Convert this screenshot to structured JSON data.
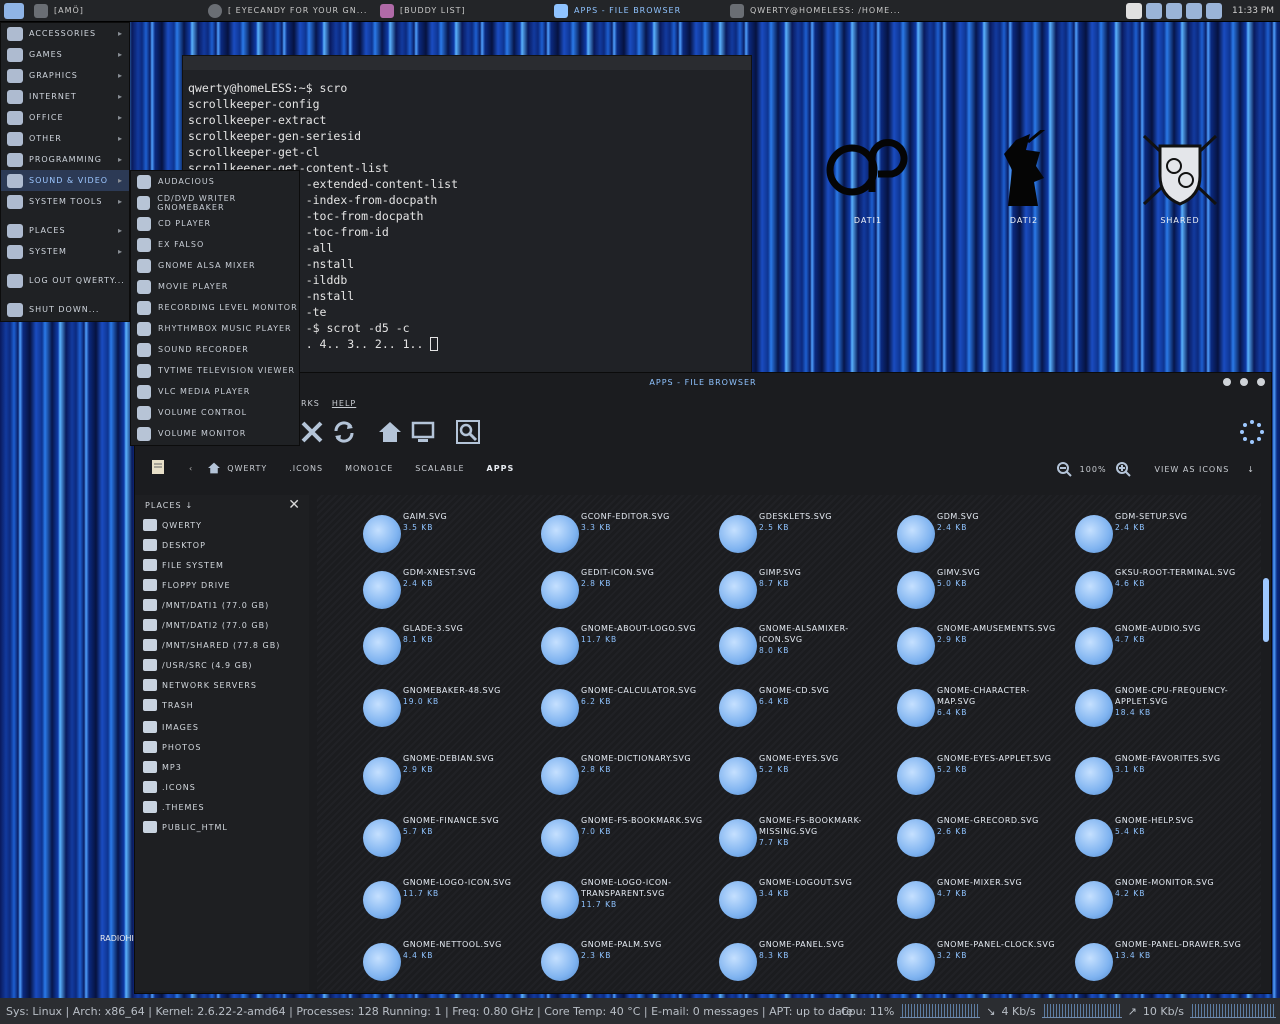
{
  "top_panel": {
    "menu_label": "[amö]",
    "tasks": [
      {
        "label": "[ eyecandy for your gn..."
      },
      {
        "label": "[buddy list]"
      },
      {
        "label": "apps - file browser"
      },
      {
        "label": "qwerty@homeless: /home..."
      }
    ],
    "clock": "11:33 PM"
  },
  "app_menu": {
    "items": [
      {
        "label": "Accessories",
        "submenu": true
      },
      {
        "label": "Games",
        "submenu": true
      },
      {
        "label": "Graphics",
        "submenu": true
      },
      {
        "label": "Internet",
        "submenu": true
      },
      {
        "label": "Office",
        "submenu": true
      },
      {
        "label": "Other",
        "submenu": true
      },
      {
        "label": "Programming",
        "submenu": true
      },
      {
        "label": "Sound & Video",
        "submenu": true,
        "active": true
      },
      {
        "label": "System Tools",
        "submenu": true
      }
    ],
    "items2": [
      {
        "label": "Places",
        "submenu": true
      },
      {
        "label": "System",
        "submenu": true
      }
    ],
    "logout": "Log Out qwerty...",
    "shutdown": "Shut Down..."
  },
  "sound_video_menu": [
    "Audacious",
    "CD/DVD Writer GnomeBaker",
    "CD Player",
    "Ex Falso",
    "GNOME ALSA Mixer",
    "Movie Player",
    "Recording Level Monitor",
    "Rhythmbox Music Player",
    "Sound Recorder",
    "tvtime Television Viewer",
    "VLC media player",
    "Volume Control",
    "Volume Monitor"
  ],
  "terminal": {
    "lines": [
      "qwerty@homeLESS:~$ scro",
      "scrollkeeper-config",
      "scrollkeeper-extract",
      "scrollkeeper-gen-seriesid",
      "scrollkeeper-get-cl",
      "scrollkeeper-get-content-list",
      "                 -extended-content-list",
      "                 -index-from-docpath",
      "                 -toc-from-docpath",
      "                 -toc-from-id",
      "                 -all",
      "                 -nstall",
      "                 -ilddb",
      "                 -nstall",
      "                 -te",
      "",
      "                 -$ scrot -d5 -c",
      "                 . 4.. 3.. 2.. 1.."
    ]
  },
  "desktop": {
    "icons": [
      {
        "label": "DATI1"
      },
      {
        "label": "DATI2"
      },
      {
        "label": "SHARED"
      }
    ],
    "radio_label": "RADIOHI"
  },
  "file_browser": {
    "title": "apps - file browser",
    "menu": [
      "rks",
      "Help"
    ],
    "breadcrumbs": [
      "qwerty",
      ".icons",
      "mono1ce",
      "scalable",
      "apps"
    ],
    "zoom": "100%",
    "view_as": "View as Icons",
    "sidebar_header": "Places",
    "places": [
      "qwerty",
      "Desktop",
      "File System",
      "Floppy Drive",
      "/mnt/dati1 (77.0 GB)",
      "/mnt/dati2 (77.0 GB)",
      "/mnt/shared (77.8 GB)",
      "/usr/src (4.9 GB)",
      "Network Servers",
      "Trash"
    ],
    "bookmarks": [
      "images",
      "photos",
      "mp3",
      ".icons",
      ".themes",
      "public_html"
    ],
    "files": [
      {
        "name": "gaim.svg",
        "size": "3.5 KB"
      },
      {
        "name": "gconf-editor.svg",
        "size": "3.3 KB"
      },
      {
        "name": "gdesklets.svg",
        "size": "2.5 KB"
      },
      {
        "name": "gdm.svg",
        "size": "2.4 KB"
      },
      {
        "name": "gdm-setup.svg",
        "size": "2.4 KB"
      },
      {
        "name": "gdm-xnest.svg",
        "size": "2.4 KB"
      },
      {
        "name": "gedit-icon.svg",
        "size": "2.8 KB"
      },
      {
        "name": "gimp.svg",
        "size": "8.7 KB"
      },
      {
        "name": "gimv.svg",
        "size": "5.0 KB"
      },
      {
        "name": "gksu-root-terminal.svg",
        "size": "4.6 KB"
      },
      {
        "name": "glade-3.svg",
        "size": "8.1 KB"
      },
      {
        "name": "gnome-about-logo.svg",
        "size": "11.7 KB"
      },
      {
        "name": "gnome-alsamixer-icon.svg",
        "size": "8.0 KB"
      },
      {
        "name": "gnome-amusements.svg",
        "size": "2.9 KB"
      },
      {
        "name": "gnome-audio.svg",
        "size": "4.7 KB"
      },
      {
        "name": "gnomebaker-48.svg",
        "size": "19.0 KB"
      },
      {
        "name": "gnome-calculator.svg",
        "size": "6.2 KB"
      },
      {
        "name": "gnome-cd.svg",
        "size": "6.4 KB"
      },
      {
        "name": "gnome-character-map.svg",
        "size": "6.4 KB"
      },
      {
        "name": "gnome-cpu-frequency-applet.svg",
        "size": "18.4 KB"
      },
      {
        "name": "gnome-debian.svg",
        "size": "2.9 KB"
      },
      {
        "name": "gnome-dictionary.svg",
        "size": "2.8 KB"
      },
      {
        "name": "gnome-eyes.svg",
        "size": "5.2 KB"
      },
      {
        "name": "gnome-eyes-applet.svg",
        "size": "5.2 KB"
      },
      {
        "name": "gnome-favorites.svg",
        "size": "3.1 KB"
      },
      {
        "name": "gnome-finance.svg",
        "size": "5.7 KB"
      },
      {
        "name": "gnome-fs-bookmark.svg",
        "size": "7.0 KB"
      },
      {
        "name": "gnome-fs-bookmark-missing.svg",
        "size": "7.7 KB"
      },
      {
        "name": "gnome-grecord.svg",
        "size": "2.6 KB"
      },
      {
        "name": "gnome-help.svg",
        "size": "5.4 KB"
      },
      {
        "name": "gnome-logo-icon.svg",
        "size": "11.7 KB"
      },
      {
        "name": "gnome-logo-icon-transparent.svg",
        "size": "11.7 KB"
      },
      {
        "name": "gnome-logout.svg",
        "size": "3.4 KB"
      },
      {
        "name": "gnome-mixer.svg",
        "size": "4.7 KB"
      },
      {
        "name": "gnome-monitor.svg",
        "size": "4.2 KB"
      },
      {
        "name": "gnome-nettool.svg",
        "size": "4.4 KB"
      },
      {
        "name": "gnome-palm.svg",
        "size": "2.3 KB"
      },
      {
        "name": "gnome-panel.svg",
        "size": "8.3 KB"
      },
      {
        "name": "gnome-panel-clock.svg",
        "size": "3.2 KB"
      },
      {
        "name": "gnome-panel-drawer.svg",
        "size": "13.4 KB"
      }
    ]
  },
  "status_bar": {
    "left": "Sys: Linux | Arch: x86_64 | Kernel: 2.6.22-2-amd64 | Processes: 128  Running: 1 | Freq: 0.80 GHz | Core Temp: 40 °C | E-mail: 0 messages | APT: up to date",
    "cpu": "Cpu: 11%",
    "down": "4 Kb/s",
    "up": "10 Kb/s"
  },
  "colors": {
    "accent": "#8fc3ff",
    "panel": "#232528",
    "window": "#1b1c1f"
  }
}
